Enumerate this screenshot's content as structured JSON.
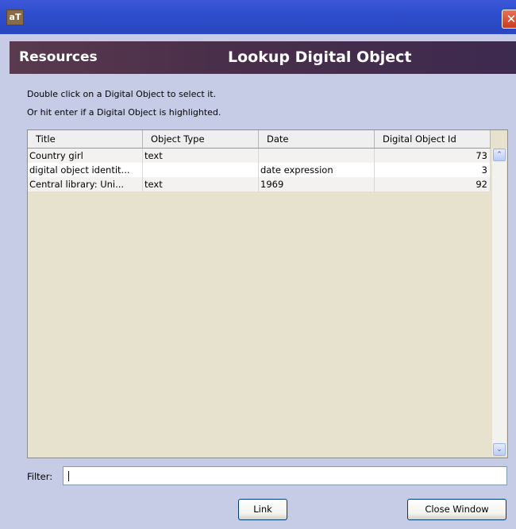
{
  "window": {
    "app_icon_text": "aT",
    "close_glyph": "✕"
  },
  "header": {
    "left_title": "Resources",
    "right_title": "Lookup Digital Object"
  },
  "instructions": {
    "line1": "Double click on a Digital Object to select it.",
    "line2": "Or hit enter if a Digital Object is highlighted."
  },
  "table": {
    "columns": [
      "Title",
      "Object Type",
      "Date",
      "Digital Object Id"
    ],
    "rows": [
      {
        "title": "Country girl",
        "object_type": "text",
        "date": "",
        "id": "73"
      },
      {
        "title": "digital object identit...",
        "object_type": "",
        "date": "date expression",
        "id": "3"
      },
      {
        "title": "Central library:  Uni...",
        "object_type": "text",
        "date": "1969",
        "id": "92"
      }
    ],
    "scroll_up_glyph": "⌃",
    "scroll_down_glyph": "⌄"
  },
  "filter": {
    "label": "Filter:",
    "value": ""
  },
  "buttons": {
    "link": "Link",
    "close_window": "Close Window"
  },
  "colors": {
    "titlebar": "#2f4fcf",
    "header": "#4a2f4a",
    "background": "#c7cce6",
    "table_bg": "#e6e2cd"
  }
}
